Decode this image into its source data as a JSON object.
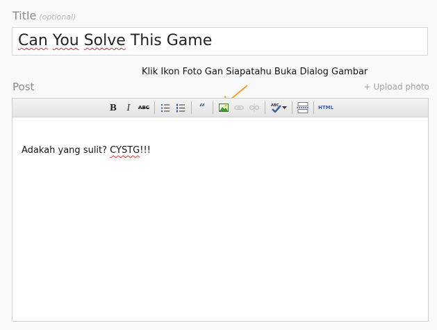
{
  "title_section": {
    "label": "Title",
    "optional_text": "(optional)",
    "value_parts": [
      "Can",
      " ",
      "You",
      " ",
      "Solve",
      " This Game"
    ]
  },
  "annotation": "Klik Ikon Foto Gan Siapatahu Buka Dialog Gambar",
  "post_section": {
    "label": "Post",
    "upload_link": "+ Upload photo"
  },
  "toolbar": {
    "bold": "B",
    "italic": "I",
    "strikethrough": "ABC",
    "blockquote": "“",
    "html": "HTML"
  },
  "editor": {
    "content_plain": "Adakah yang sulit? ",
    "content_misspelled": "CYSTG",
    "content_end": "!!!"
  },
  "colors": {
    "arrow": "#f0a030",
    "icon_blue": "#3a5ea8",
    "image_icon_green": "#3c9a2c"
  }
}
